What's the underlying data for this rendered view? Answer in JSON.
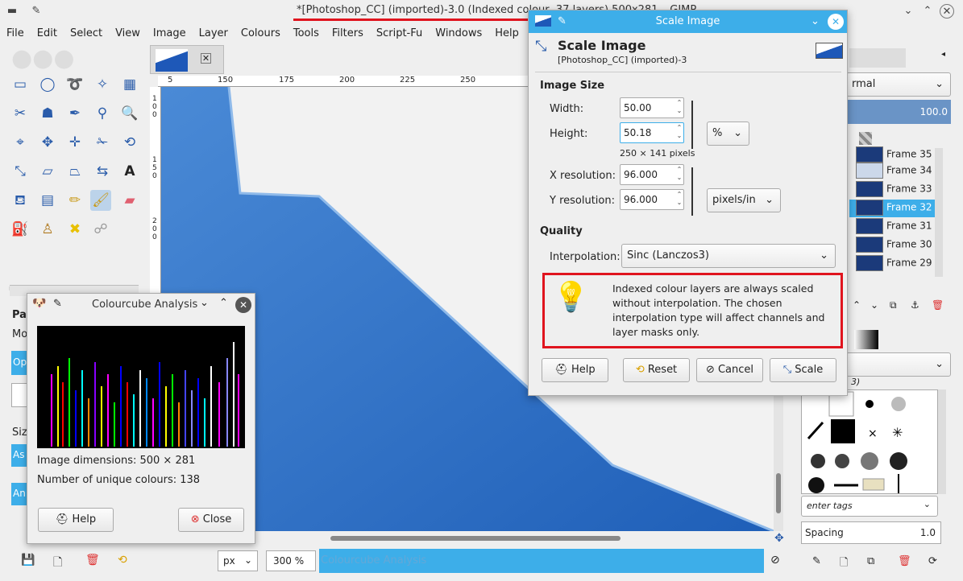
{
  "window": {
    "title": "*[Photoshop_CC] (imported)-3.0 (Indexed colour, 37 layers) 500x281 – GIMP"
  },
  "menu": [
    "File",
    "Edit",
    "Select",
    "View",
    "Image",
    "Layer",
    "Colours",
    "Tools",
    "Filters",
    "Script-Fu",
    "Windows",
    "Help"
  ],
  "ruler_h": [
    "5",
    "150",
    "175",
    "200",
    "225",
    "250"
  ],
  "ruler_v": [
    "1",
    "0",
    "0",
    "1",
    "5",
    "0",
    "2",
    "0",
    "0"
  ],
  "status": {
    "unit": "px",
    "zoom": "300 %",
    "message": "Colourcube Analysis"
  },
  "colourcube": {
    "title": "Colourcube Analysis",
    "dimensions": "Image dimensions: 500 × 281",
    "unique": "Number of unique colours: 138",
    "help": "Help",
    "close": "Close"
  },
  "scale_dialog": {
    "window_title": "Scale Image",
    "heading": "Scale Image",
    "subheading": "[Photoshop_CC] (imported)-3",
    "image_size": "Image Size",
    "width_label": "Width:",
    "width_value": "50.00",
    "height_label": "Height:",
    "height_value": "50.18",
    "size_unit": "%",
    "pixels_info": "250 × 141 pixels",
    "xres_label": "X resolution:",
    "xres_value": "96.000",
    "yres_label": "Y resolution:",
    "yres_value": "96.000",
    "res_unit": "pixels/in",
    "quality": "Quality",
    "interp_label": "Interpolation:",
    "interp_value": "Sinc (Lanczos3)",
    "note": "Indexed colour layers are always scaled without interpolation. The chosen interpolation type will affect channels and layer masks only.",
    "help": "Help",
    "reset": "Reset",
    "cancel": "Cancel",
    "scale": "Scale"
  },
  "dock": {
    "mode": "rmal",
    "opacity": "100.0",
    "frames": [
      "Frame 35 (",
      "Frame 34 (",
      "Frame 33 (",
      "Frame 32 (",
      "Frame 31 (",
      "Frame 30 (",
      "Frame 29 ("
    ],
    "brush_name": "3)",
    "tags_placeholder": "enter tags",
    "spacing_label": "Spacing",
    "spacing_value": "1.0"
  },
  "toolbox": {
    "partial_labels": [
      "Pa",
      "Mo",
      "Op",
      "Siz",
      "As",
      "An"
    ]
  },
  "colors": {
    "accent": "#3daee9",
    "highlight": "#e0141e",
    "canvas_blue": "#2f73c8"
  }
}
